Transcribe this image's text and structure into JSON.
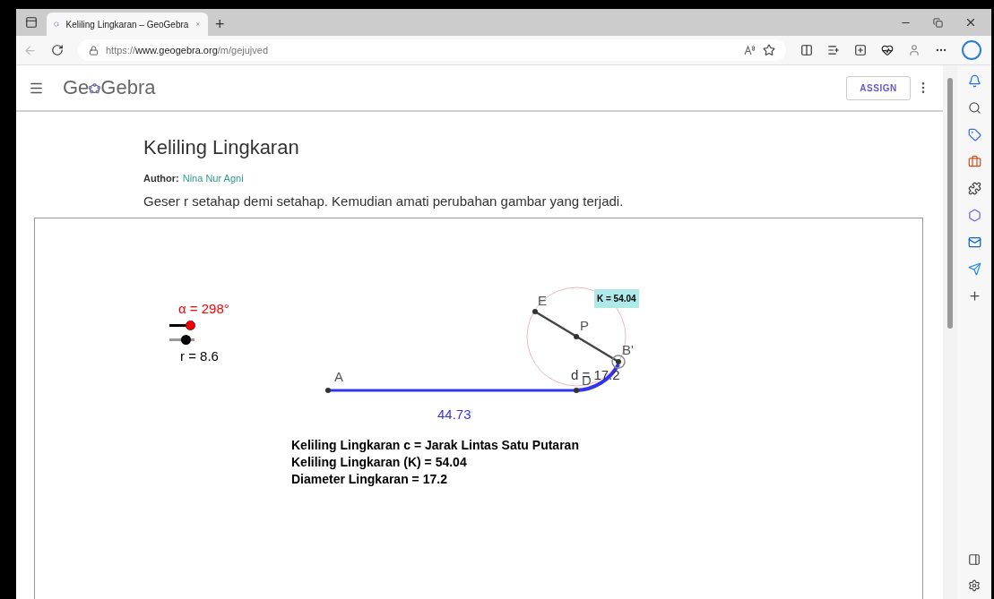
{
  "browser": {
    "tab_title": "Keliling Lingkaran – GeoGebra",
    "new_tab": "+",
    "url": {
      "scheme": "https://",
      "host": "www.geogebra.org",
      "path": "/m/gejujved"
    }
  },
  "header": {
    "logo": [
      "Ge",
      "Gebra"
    ],
    "assign": "ASSIGN"
  },
  "page": {
    "title": "Keliling Lingkaran",
    "author_label": "Author:",
    "author": "Nina Nur Agni",
    "instruction": "Geser r setahap demi setahap. Kemudian amati perubahan gambar yang terjadi."
  },
  "applet": {
    "sliders": [
      {
        "label": "α = 298°",
        "level": 0.83,
        "color": "#ff0000"
      },
      {
        "label": "r = 8.6",
        "level": 0.65,
        "color": "#000000"
      }
    ],
    "points": [
      {
        "label": "A"
      },
      {
        "label": "E"
      },
      {
        "label": "P"
      },
      {
        "label": "D"
      },
      {
        "label": "B'"
      }
    ],
    "segment_length": "44.73",
    "diameter_label": "d = 17.2",
    "circumference_box": "K = 54.04",
    "texts": [
      "Keliling Lingkaran c = Jarak Lintas Satu Putaran",
      "Keliling Lingkaran (K) = 54.04",
      "Diameter Lingkaran = 17.2"
    ]
  }
}
